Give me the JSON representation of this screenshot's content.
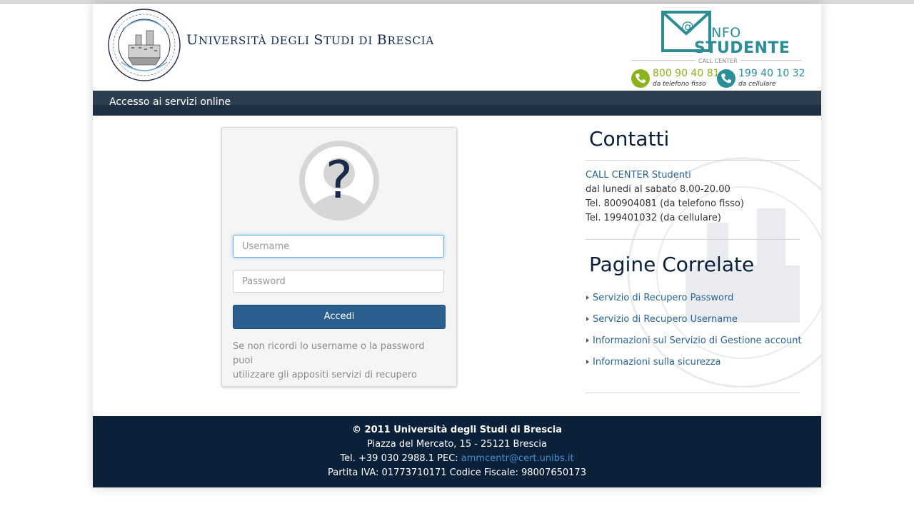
{
  "header": {
    "title_first": "U",
    "title_rest": "NIVERSITÀ DEGLI ",
    "title_s": "S",
    "title_tudi": "TUDI DI ",
    "title_b": "B",
    "title_rescia": "RESCIA",
    "seal_text": "UNIVERSITAS STUDIORUM BRIXIAE",
    "info_logo": {
      "info": "INFO",
      "studente": "STUDENTE",
      "call_center": "CALL CENTER",
      "phone1": {
        "number": "800 90 40 81",
        "sub": "da telefono fisso",
        "color": "#8ab31c"
      },
      "phone2": {
        "number": "199 40 10 32",
        "sub": "da cellulare",
        "color": "#2b8e97"
      }
    }
  },
  "nav": {
    "label": "Accesso ai servizi online"
  },
  "login": {
    "username_placeholder": "Username",
    "password_placeholder": "Password",
    "submit_label": "Accedi",
    "hint_line1": "Se non ricordi lo username o la password puoi",
    "hint_line2": "utilizzare gli appositi servizi di recupero"
  },
  "contatti": {
    "heading": "Contatti",
    "link": "CALL CENTER Studenti",
    "hours": "dal lunedi al sabato 8.00-20.00",
    "tel_fixed": "Tel. 800904081 (da telefono fisso)",
    "tel_mobile": "Tel. 199401032 (da cellulare)"
  },
  "pagine": {
    "heading": "Pagine Correlate",
    "links": [
      "Servizio di Recupero Password",
      "Servizio di Recupero Username",
      "Informazioni sul Servizio di Gestione account",
      "Informazioni sulla sicurezza"
    ]
  },
  "footer": {
    "line1": "© 2011 Università degli Studi di Brescia",
    "line2": "Piazza del Mercato, 15 - 25121 Brescia",
    "line3_prefix": "Tel. +39 030 2988.1 PEC: ",
    "line3_email": "ammcentr@cert.unibs.it",
    "line4": "Partita IVA: 01773710171 Codice Fiscale: 98007650173"
  },
  "colors": {
    "brand_navy": "#0b2039",
    "nav_bar": "#2c3e50",
    "button": "#2a5f8f",
    "link": "#2a6496",
    "info_teal": "#2b8e97",
    "phone_green": "#8ab31c"
  }
}
